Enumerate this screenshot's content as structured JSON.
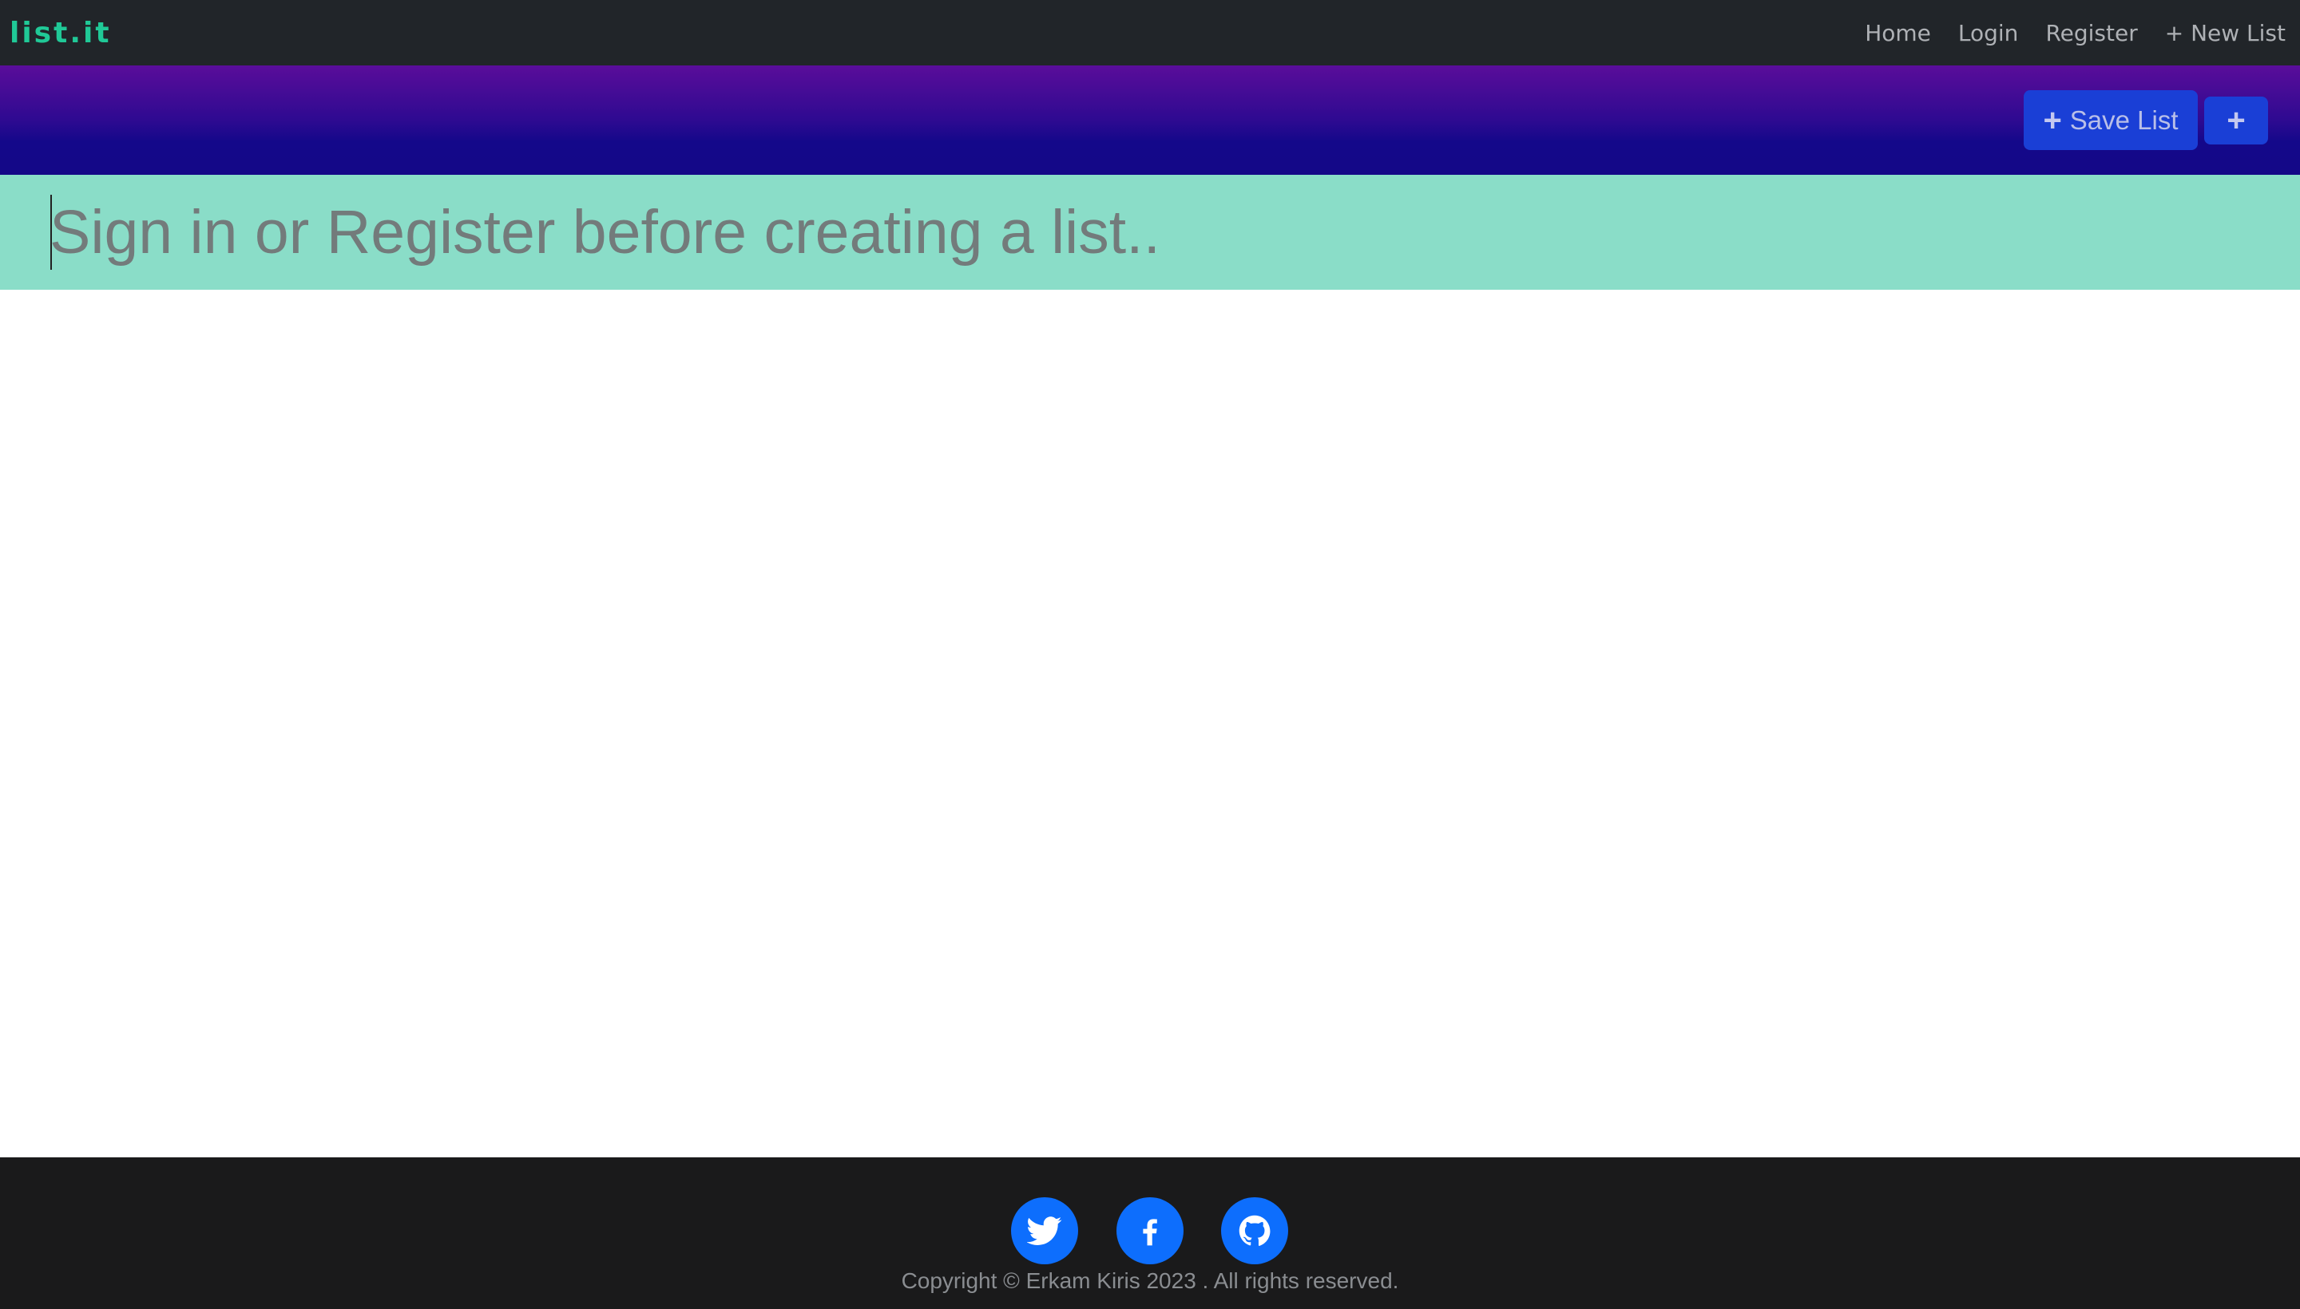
{
  "navbar": {
    "brand": "list.it",
    "links": [
      "Home",
      "Login",
      "Register",
      "+ New List"
    ]
  },
  "toolbar": {
    "save_label": "Save List",
    "add_icon": "plus-icon"
  },
  "title_input": {
    "placeholder": "Sign in or Register before creating a list..",
    "value": ""
  },
  "footer": {
    "social": [
      "twitter-icon",
      "facebook-icon",
      "github-icon"
    ],
    "copyright": "Copyright © Erkam Kiris 2023 . All rights reserved."
  },
  "colors": {
    "navbar_bg": "#212529",
    "brand": "#20c997",
    "toolbar_gradient_top": "#5a0d9a",
    "toolbar_gradient_bottom": "#140887",
    "button": "#1a3fd6",
    "title_bar_bg": "#8addc8",
    "footer_bg": "#1a1a1b",
    "social_icon_bg": "#0d6efd"
  }
}
